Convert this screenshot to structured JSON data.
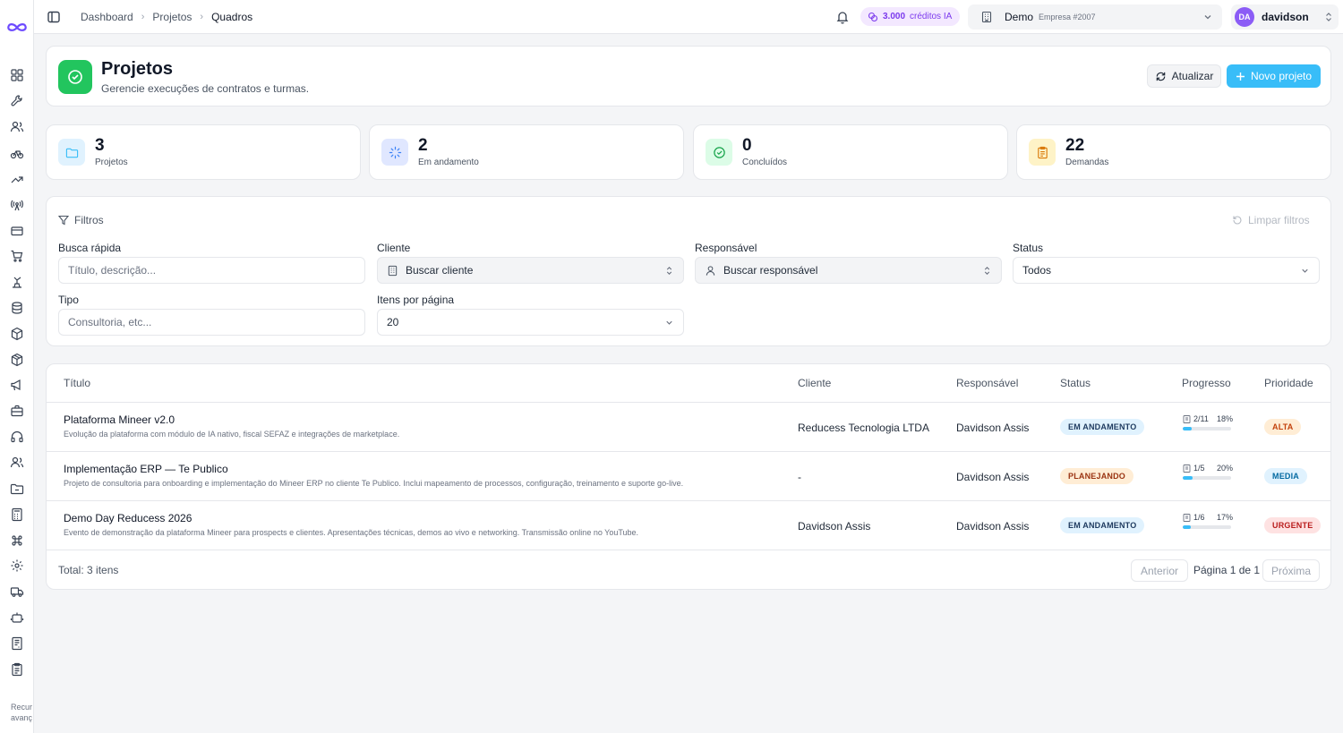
{
  "breadcrumb": [
    "Dashboard",
    "Projetos",
    "Quadros"
  ],
  "topbar": {
    "credits_amount": "3.000",
    "credits_label": "créditos IA",
    "company_name": "Demo",
    "company_sub": "Empresa #2007",
    "user_initials": "DA",
    "user_name": "davidson"
  },
  "sidebar": {
    "icons": [
      "dashboard-icon",
      "wrench-icon",
      "users-icon",
      "bike-icon",
      "trending-up-icon",
      "radio-tower-icon",
      "credit-card-icon",
      "cart-icon",
      "lamp-icon",
      "database-icon",
      "package-icon",
      "box-icon",
      "megaphone-icon",
      "briefcase-icon",
      "headphones-icon",
      "user-group-icon",
      "folder-icon",
      "calculator-icon",
      "command-icon",
      "settings-icon",
      "truck-icon",
      "bot-icon",
      "receipt-icon",
      "clipboard-icon"
    ],
    "footer_text": [
      "Recur",
      "avanç"
    ]
  },
  "header": {
    "title": "Projetos",
    "subtitle": "Gerencie execuções de contratos e turmas.",
    "refresh_label": "Atualizar",
    "new_label": "Novo projeto"
  },
  "stats": [
    {
      "value": "3",
      "label": "Projetos",
      "icon": "folder-icon",
      "color": "#38bdf8"
    },
    {
      "value": "2",
      "label": "Em andamento",
      "icon": "loader-icon",
      "color": "#3b82f6"
    },
    {
      "value": "0",
      "label": "Concluídos",
      "icon": "check-circle-icon",
      "color": "#22c55e"
    },
    {
      "value": "22",
      "label": "Demandas",
      "icon": "clipboard-icon",
      "color": "#f59e0b"
    }
  ],
  "filters": {
    "title": "Filtros",
    "clear_label": "Limpar filtros",
    "busca_label": "Busca rápida",
    "busca_placeholder": "Título, descrição...",
    "cliente_label": "Cliente",
    "cliente_value": "Buscar cliente",
    "responsavel_label": "Responsável",
    "responsavel_value": "Buscar responsável",
    "status_label": "Status",
    "status_value": "Todos",
    "tipo_label": "Tipo",
    "tipo_placeholder": "Consultoria, etc...",
    "itens_label": "Itens por página",
    "itens_value": "20"
  },
  "table": {
    "headers": [
      "Título",
      "Cliente",
      "Responsável",
      "Status",
      "Progresso",
      "Prioridade"
    ],
    "rows": [
      {
        "title": "Plataforma Mineer v2.0",
        "desc": "Evolução da plataforma com módulo de IA nativo, fiscal SEFAZ e integrações de marketplace.",
        "cliente": "Reducess Tecnologia LTDA",
        "responsavel": "Davidson Assis",
        "status": "EM ANDAMENTO",
        "tasks": "2/11",
        "progress": 18,
        "progress_label": "18%",
        "priority": "ALTA"
      },
      {
        "title": "Implementação ERP — Te Publico",
        "desc": "Projeto de consultoria para onboarding e implementação do Mineer ERP no cliente Te Publico. Inclui mapeamento de processos, configuração, treinamento e suporte go-live.",
        "cliente": "-",
        "responsavel": "Davidson Assis",
        "status": "PLANEJANDO",
        "tasks": "1/5",
        "progress": 20,
        "progress_label": "20%",
        "priority": "MEDIA"
      },
      {
        "title": "Demo Day Reducess 2026",
        "desc": "Evento de demonstração da plataforma Mineer para prospects e clientes. Apresentações técnicas, demos ao vivo e networking. Transmissão online no YouTube.",
        "cliente": "Davidson Assis",
        "responsavel": "Davidson Assis",
        "status": "EM ANDAMENTO",
        "tasks": "1/6",
        "progress": 17,
        "progress_label": "17%",
        "priority": "URGENTE"
      }
    ],
    "total_label": "Total: 3 itens",
    "prev_label": "Anterior",
    "page_label": "Página 1 de 1",
    "next_label": "Próxima"
  }
}
